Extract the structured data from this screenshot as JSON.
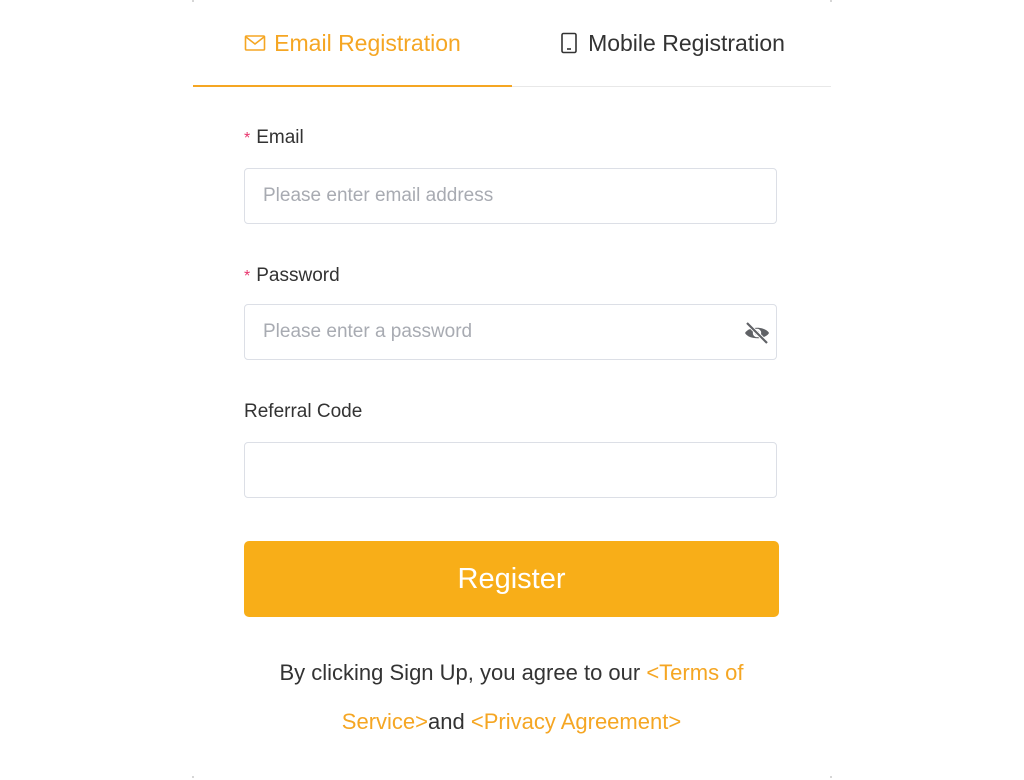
{
  "tabs": {
    "email": "Email Registration",
    "mobile": "Mobile Registration"
  },
  "form": {
    "email_label": "Email",
    "email_placeholder": "Please enter email address",
    "password_label": "Password",
    "password_placeholder": "Please enter a password",
    "referral_label": "Referral Code",
    "referral_placeholder": "",
    "required_mark": "*"
  },
  "register_label": "Register",
  "terms": {
    "prefix": "By clicking Sign Up, you agree to our ",
    "terms_link": "<Terms of Service>",
    "middle": "and ",
    "privacy_link": "<Privacy Agreement>"
  },
  "icons": {
    "email_tab": "mail-icon",
    "mobile_tab": "mobile-phone-icon",
    "password_toggle": "eye-off-icon"
  },
  "colors": {
    "accent": "#f5a623",
    "button": "#f8ae18",
    "required": "#e8356d",
    "text": "#333333",
    "placeholder": "#a8abb2",
    "border": "#dcdfe6"
  }
}
